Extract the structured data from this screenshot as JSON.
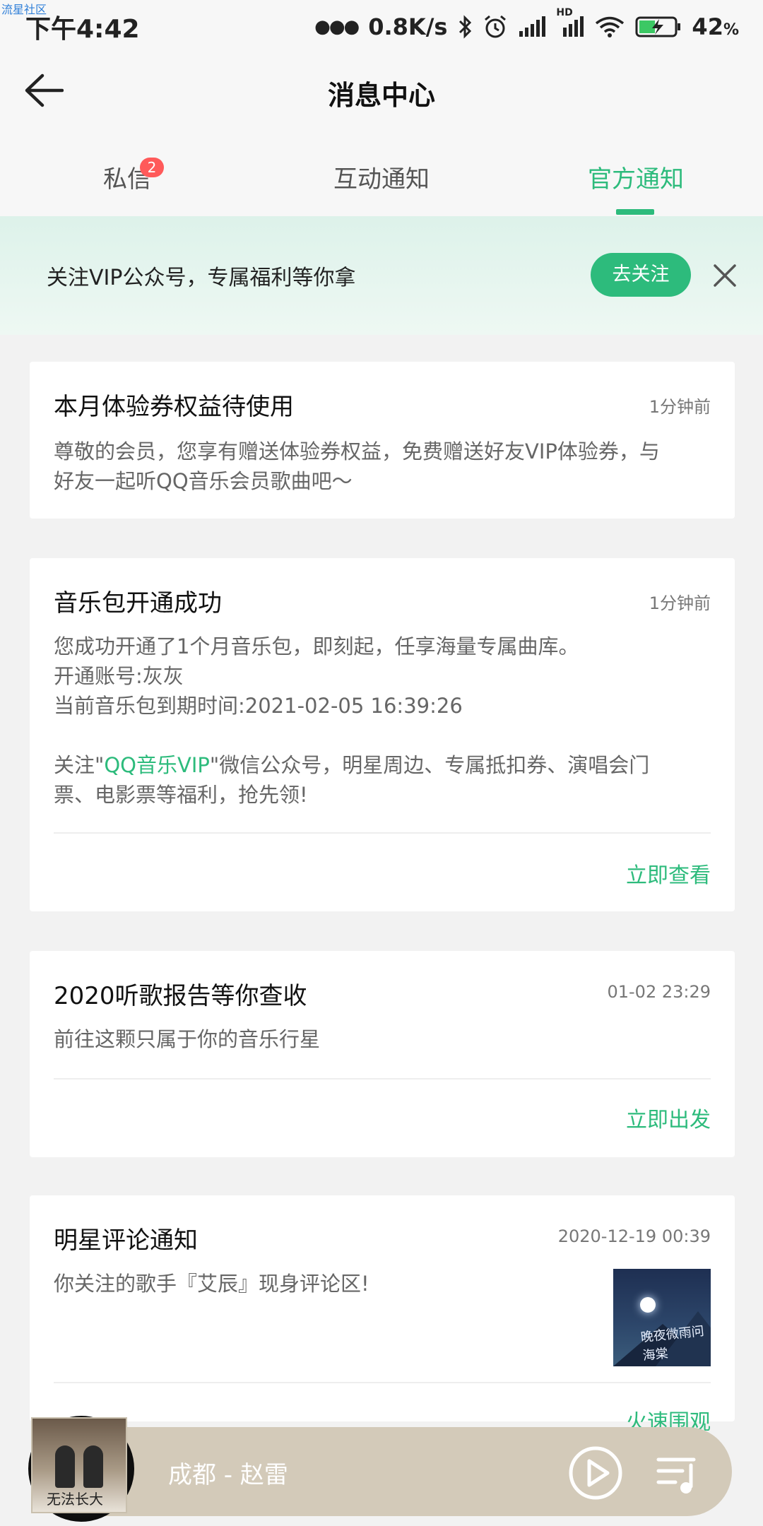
{
  "watermark": "流星社区",
  "status_bar": {
    "time": "下午4:42",
    "network_speed": "0.8K/s",
    "hd": "HD",
    "battery": "42",
    "battery_unit": "%"
  },
  "header": {
    "title": "消息中心"
  },
  "tabs": [
    {
      "label": "私信",
      "badge": "2",
      "active": false
    },
    {
      "label": "互动通知",
      "active": false
    },
    {
      "label": "官方通知",
      "active": true
    }
  ],
  "banner": {
    "text": "关注VIP公众号，专属福利等你拿",
    "follow_label": "去关注"
  },
  "cards": [
    {
      "title": "本月体验券权益待使用",
      "time": "1分钟前",
      "body_line1": "尊敬的会员，您享有赠送体验券权益，免费赠送好友VIP体验券，与",
      "body_line2": "好友一起听QQ音乐会员歌曲吧～"
    },
    {
      "title": "音乐包开通成功",
      "time": "1分钟前",
      "body_line1": "您成功开通了1个月音乐包，即刻起，任享海量专属曲库。",
      "body_line2": "开通账号:灰灰",
      "body_line3": "当前音乐包到期时间:2021-02-05 16:39:26",
      "follow_prefix": "关注\"",
      "follow_link": "QQ音乐VIP",
      "follow_suffix": "\"微信公众号，明星周边、专属抵扣券、演唱会门",
      "follow_line2": "票、电影票等福利，抢先领!",
      "action": "立即查看"
    },
    {
      "title": "2020听歌报告等你查收",
      "time": "01-02 23:29",
      "body_line1": "前往这颗只属于你的音乐行星",
      "action": "立即出发"
    },
    {
      "title": "明星评论通知",
      "time": "2020-12-19 00:39",
      "body_line1": "你关注的歌手『艾辰』现身评论区!",
      "thumb_text": "晚夜微雨问海棠",
      "action": "火速围观"
    }
  ],
  "player": {
    "song": "成都 - 赵雷",
    "cover_text": "无法长大"
  },
  "colors": {
    "accent": "#2dbb7c",
    "badge": "#ff5a5a",
    "banner_bg": "#e5f5ee",
    "player_bg": "#d3cab9"
  }
}
